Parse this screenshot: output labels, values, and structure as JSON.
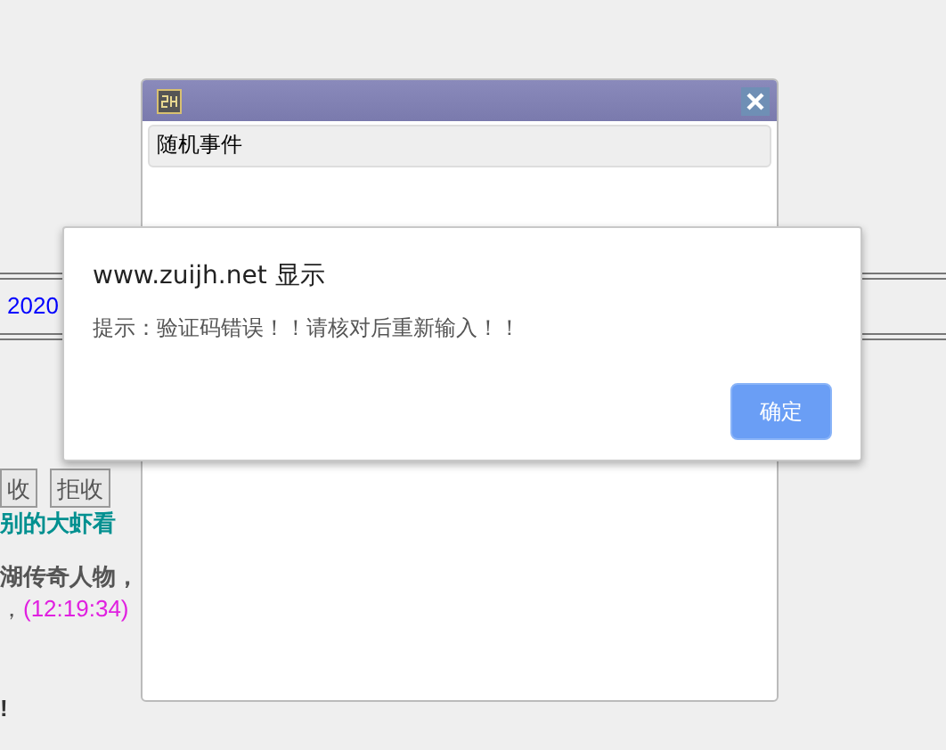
{
  "background_page": {
    "date_text": "2020",
    "buttons": [
      {
        "label": "收"
      },
      {
        "label": "拒收"
      }
    ],
    "lines": [
      {
        "kind": "notice",
        "text": "别的大虾看"
      },
      {
        "kind": "story",
        "text": "湖传奇人物，"
      },
      {
        "kind": "timed",
        "text": "，",
        "time": "(12:19:34)"
      },
      {
        "kind": "shout",
        "text": "!"
      }
    ]
  },
  "window": {
    "tabs": [
      {
        "label": "随机事件",
        "selected": true
      }
    ]
  },
  "alert": {
    "title": "www.zuijh.net 显示",
    "message": "提示：验证码错误！！请核对后重新输入！！",
    "buttons": [
      "确定"
    ]
  }
}
